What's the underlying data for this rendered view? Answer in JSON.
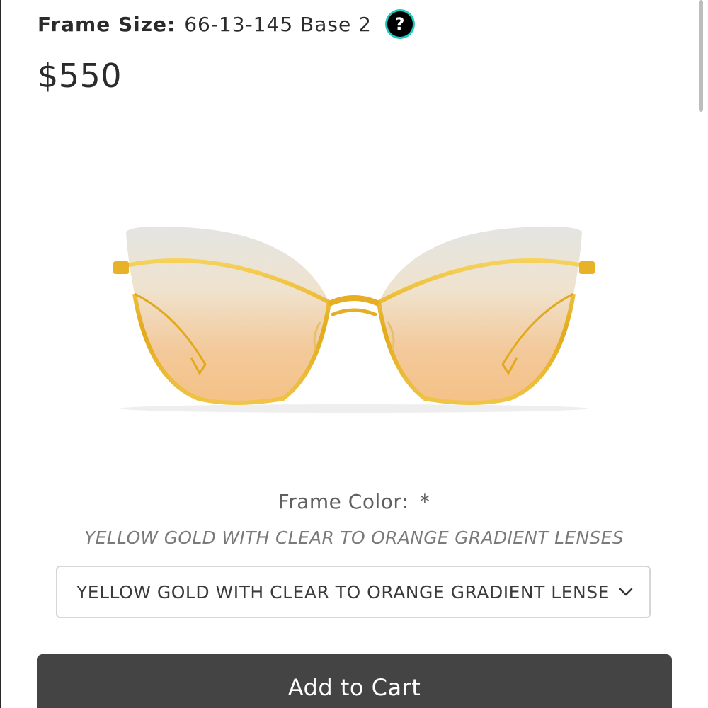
{
  "frame_size": {
    "label": "Frame Size",
    "value": "66-13-145 Base 2",
    "help_icon": "question-circle-icon"
  },
  "price": "$550",
  "product_image": {
    "name": "gold cat-eye sunglasses with clear to orange gradient lenses"
  },
  "frame_color": {
    "label": "Frame Color:",
    "required_marker": "*",
    "selected_text": "YELLOW GOLD WITH CLEAR TO ORANGE GRADIENT LENSES",
    "select_value": "YELLOW GOLD WITH CLEAR TO ORANGE GRADIENT LENSES",
    "select_icon": "chevron-down-icon"
  },
  "cart": {
    "button_label": "Add to Cart"
  },
  "colors": {
    "button_bg": "#444444",
    "help_icon_ring": "#1ec9bd",
    "frame_gold": "#e9b62f"
  }
}
